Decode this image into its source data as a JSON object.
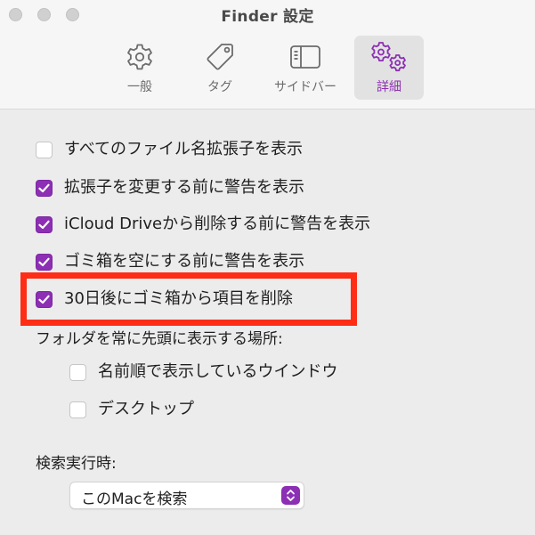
{
  "window": {
    "title": "Finder 設定"
  },
  "tabs": [
    {
      "label": "一般",
      "icon": "gear-icon",
      "selected": false
    },
    {
      "label": "タグ",
      "icon": "tag-icon",
      "selected": false
    },
    {
      "label": "サイドバー",
      "icon": "sidebar-icon",
      "selected": false
    },
    {
      "label": "詳細",
      "icon": "gears-icon",
      "selected": true
    }
  ],
  "options": [
    {
      "label": "すべてのファイル名拡張子を表示",
      "checked": false
    },
    {
      "label": "拡張子を変更する前に警告を表示",
      "checked": true
    },
    {
      "label": "iCloud Driveから削除する前に警告を表示",
      "checked": true
    },
    {
      "label": "ゴミ箱を空にする前に警告を表示",
      "checked": true
    },
    {
      "label": "30日後にゴミ箱から項目を削除",
      "checked": true
    }
  ],
  "folders_on_top": {
    "heading": "フォルダを常に先頭に表示する場所:",
    "options": [
      {
        "label": "名前順で表示しているウインドウ",
        "checked": false
      },
      {
        "label": "デスクトップ",
        "checked": false
      }
    ]
  },
  "search": {
    "heading": "検索実行時:",
    "selected_value": "このMacを検索"
  },
  "colors": {
    "accent": "#8c2fb4",
    "highlight_box": "#ff2d16"
  }
}
